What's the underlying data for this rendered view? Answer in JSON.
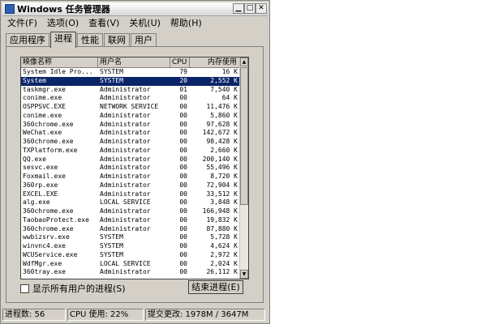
{
  "window": {
    "title": "Windows 任务管理器"
  },
  "menu": [
    "文件(F)",
    "选项(O)",
    "查看(V)",
    "关机(U)",
    "帮助(H)"
  ],
  "tabs": [
    "应用程序",
    "进程",
    "性能",
    "联网",
    "用户"
  ],
  "active_tab": "进程",
  "table": {
    "headers": {
      "name": "映像名称",
      "user": "用户名",
      "cpu": "CPU",
      "mem": "内存使用"
    },
    "rows": [
      {
        "name": "System Idle Pro...",
        "user": "SYSTEM",
        "cpu": "79",
        "mem": "16 K"
      },
      {
        "name": "System",
        "user": "SYSTEM",
        "cpu": "20",
        "mem": "2,552 K",
        "selected": true
      },
      {
        "name": "taskmgr.exe",
        "user": "Administrator",
        "cpu": "01",
        "mem": "7,540 K"
      },
      {
        "name": "conime.exe",
        "user": "Administrator",
        "cpu": "00",
        "mem": "64 K"
      },
      {
        "name": "OSPPSVC.EXE",
        "user": "NETWORK SERVICE",
        "cpu": "00",
        "mem": "11,476 K"
      },
      {
        "name": "conime.exe",
        "user": "Administrator",
        "cpu": "00",
        "mem": "5,860 K"
      },
      {
        "name": "360chrome.exe",
        "user": "Administrator",
        "cpu": "00",
        "mem": "97,628 K"
      },
      {
        "name": "WeChat.exe",
        "user": "Administrator",
        "cpu": "00",
        "mem": "142,672 K"
      },
      {
        "name": "360chrome.exe",
        "user": "Administrator",
        "cpu": "00",
        "mem": "98,428 K"
      },
      {
        "name": "TXPlatform.exe",
        "user": "Administrator",
        "cpu": "00",
        "mem": "2,660 K"
      },
      {
        "name": "QQ.exe",
        "user": "Administrator",
        "cpu": "00",
        "mem": "200,140 K"
      },
      {
        "name": "sesvc.exe",
        "user": "Administrator",
        "cpu": "00",
        "mem": "55,496 K"
      },
      {
        "name": "Foxmail.exe",
        "user": "Administrator",
        "cpu": "00",
        "mem": "8,720 K"
      },
      {
        "name": "360rp.exe",
        "user": "Administrator",
        "cpu": "00",
        "mem": "72,904 K"
      },
      {
        "name": "EXCEL.EXE",
        "user": "Administrator",
        "cpu": "00",
        "mem": "33,512 K"
      },
      {
        "name": "alg.exe",
        "user": "LOCAL SERVICE",
        "cpu": "00",
        "mem": "3,848 K"
      },
      {
        "name": "360chrome.exe",
        "user": "Administrator",
        "cpu": "00",
        "mem": "166,948 K"
      },
      {
        "name": "TaobaoProtect.exe",
        "user": "Administrator",
        "cpu": "00",
        "mem": "19,832 K"
      },
      {
        "name": "360chrome.exe",
        "user": "Administrator",
        "cpu": "00",
        "mem": "87,880 K"
      },
      {
        "name": "wwbizsrv.exe",
        "user": "SYSTEM",
        "cpu": "00",
        "mem": "5,728 K"
      },
      {
        "name": "winvnc4.exe",
        "user": "SYSTEM",
        "cpu": "00",
        "mem": "4,624 K"
      },
      {
        "name": "WCUService.exe",
        "user": "SYSTEM",
        "cpu": "00",
        "mem": "2,972 K"
      },
      {
        "name": "WdfMgr.exe",
        "user": "LOCAL SERVICE",
        "cpu": "00",
        "mem": "2,024 K"
      },
      {
        "name": "360tray.exe",
        "user": "Administrator",
        "cpu": "00",
        "mem": "26,112 K"
      }
    ]
  },
  "show_all_users_label": "显示所有用户的进程(S)",
  "end_process_label": "结束进程(E)",
  "status": {
    "processes": "进程数: 56",
    "cpu": "CPU 使用: 22%",
    "commit": "提交更改: 1978M / 3647M"
  },
  "colors": {
    "selection": "#0a246a",
    "window_bg": "#d4d0c8"
  }
}
